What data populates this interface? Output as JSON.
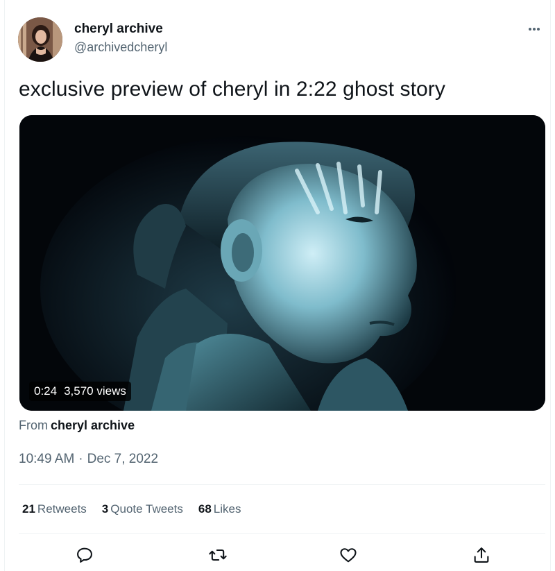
{
  "author": {
    "display_name": "cheryl archive",
    "handle": "@archivedcheryl"
  },
  "tweet": {
    "text": "exclusive preview of cheryl in 2:22 ghost story"
  },
  "video": {
    "duration": "0:24",
    "views": "3,570 views"
  },
  "source": {
    "prefix": "From",
    "name": "cheryl archive"
  },
  "meta": {
    "time": "10:49 AM",
    "separator": "·",
    "date": "Dec 7, 2022"
  },
  "stats": {
    "retweets_count": "21",
    "retweets_label": "Retweets",
    "quotes_count": "3",
    "quotes_label": "Quote Tweets",
    "likes_count": "68",
    "likes_label": "Likes"
  },
  "actions": [
    "reply-icon",
    "retweet-icon",
    "like-icon",
    "share-icon"
  ],
  "colors": {
    "text_primary": "#0f1419",
    "text_secondary": "#536471",
    "divider": "#eff3f4",
    "video_tint": "#9fd6e4"
  }
}
